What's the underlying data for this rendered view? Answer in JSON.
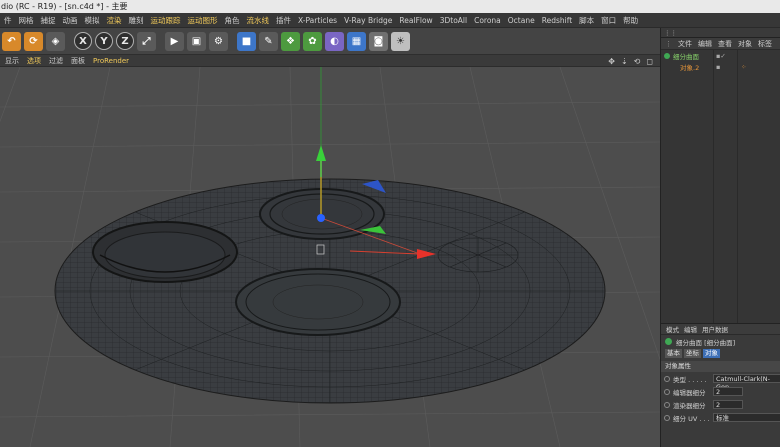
{
  "title": "dio (RC - R19) - [sn.c4d *] - 主要",
  "menu": [
    {
      "label": "件",
      "hl": false
    },
    {
      "label": "网格",
      "hl": false
    },
    {
      "label": "捕捉",
      "hl": false
    },
    {
      "label": "动画",
      "hl": false
    },
    {
      "label": "模拟",
      "hl": false
    },
    {
      "label": "渲染",
      "hl": true
    },
    {
      "label": "雕刻",
      "hl": false
    },
    {
      "label": "运动跟踪",
      "hl": true
    },
    {
      "label": "运动图形",
      "hl": true
    },
    {
      "label": "角色",
      "hl": false
    },
    {
      "label": "流水线",
      "hl": true
    },
    {
      "label": "插件",
      "hl": false
    },
    {
      "label": "X-Particles",
      "hl": false
    },
    {
      "label": "V-Ray Bridge",
      "hl": false
    },
    {
      "label": "RealFlow",
      "hl": false
    },
    {
      "label": "3DtoAll",
      "hl": false
    },
    {
      "label": "Corona",
      "hl": false
    },
    {
      "label": "Octane",
      "hl": false
    },
    {
      "label": "Redshift",
      "hl": false
    },
    {
      "label": "脚本",
      "hl": false
    },
    {
      "label": "窗口",
      "hl": false
    },
    {
      "label": "帮助",
      "hl": false
    }
  ],
  "toolbar": {
    "axis_x": "X",
    "axis_y": "Y",
    "axis_z": "Z"
  },
  "viewport_menu": {
    "items": [
      "显示",
      "选项",
      "过滤",
      "面板",
      "ProRender"
    ]
  },
  "objects_panel": {
    "tabs": [
      "文件",
      "编辑",
      "查看",
      "对象",
      "标签"
    ],
    "objects": [
      {
        "name": "细分曲面",
        "color": "green"
      },
      {
        "name": "对象.2",
        "color": "orange"
      }
    ]
  },
  "attributes": {
    "menu": [
      "模式",
      "编辑",
      "用户数据"
    ],
    "title": "细分曲面 [细分曲面]",
    "tabs": [
      "基本",
      "坐标",
      "对象"
    ],
    "active_tab": "对象",
    "section": "对象属性",
    "rows": [
      {
        "label": "类型 . . . . .",
        "value": "Catmull-Clark(N-Gon"
      },
      {
        "label": "编辑器细分",
        "value": "2"
      },
      {
        "label": "渲染器细分",
        "value": "2"
      },
      {
        "label": "细分 UV . . .",
        "value": "标准"
      }
    ]
  }
}
